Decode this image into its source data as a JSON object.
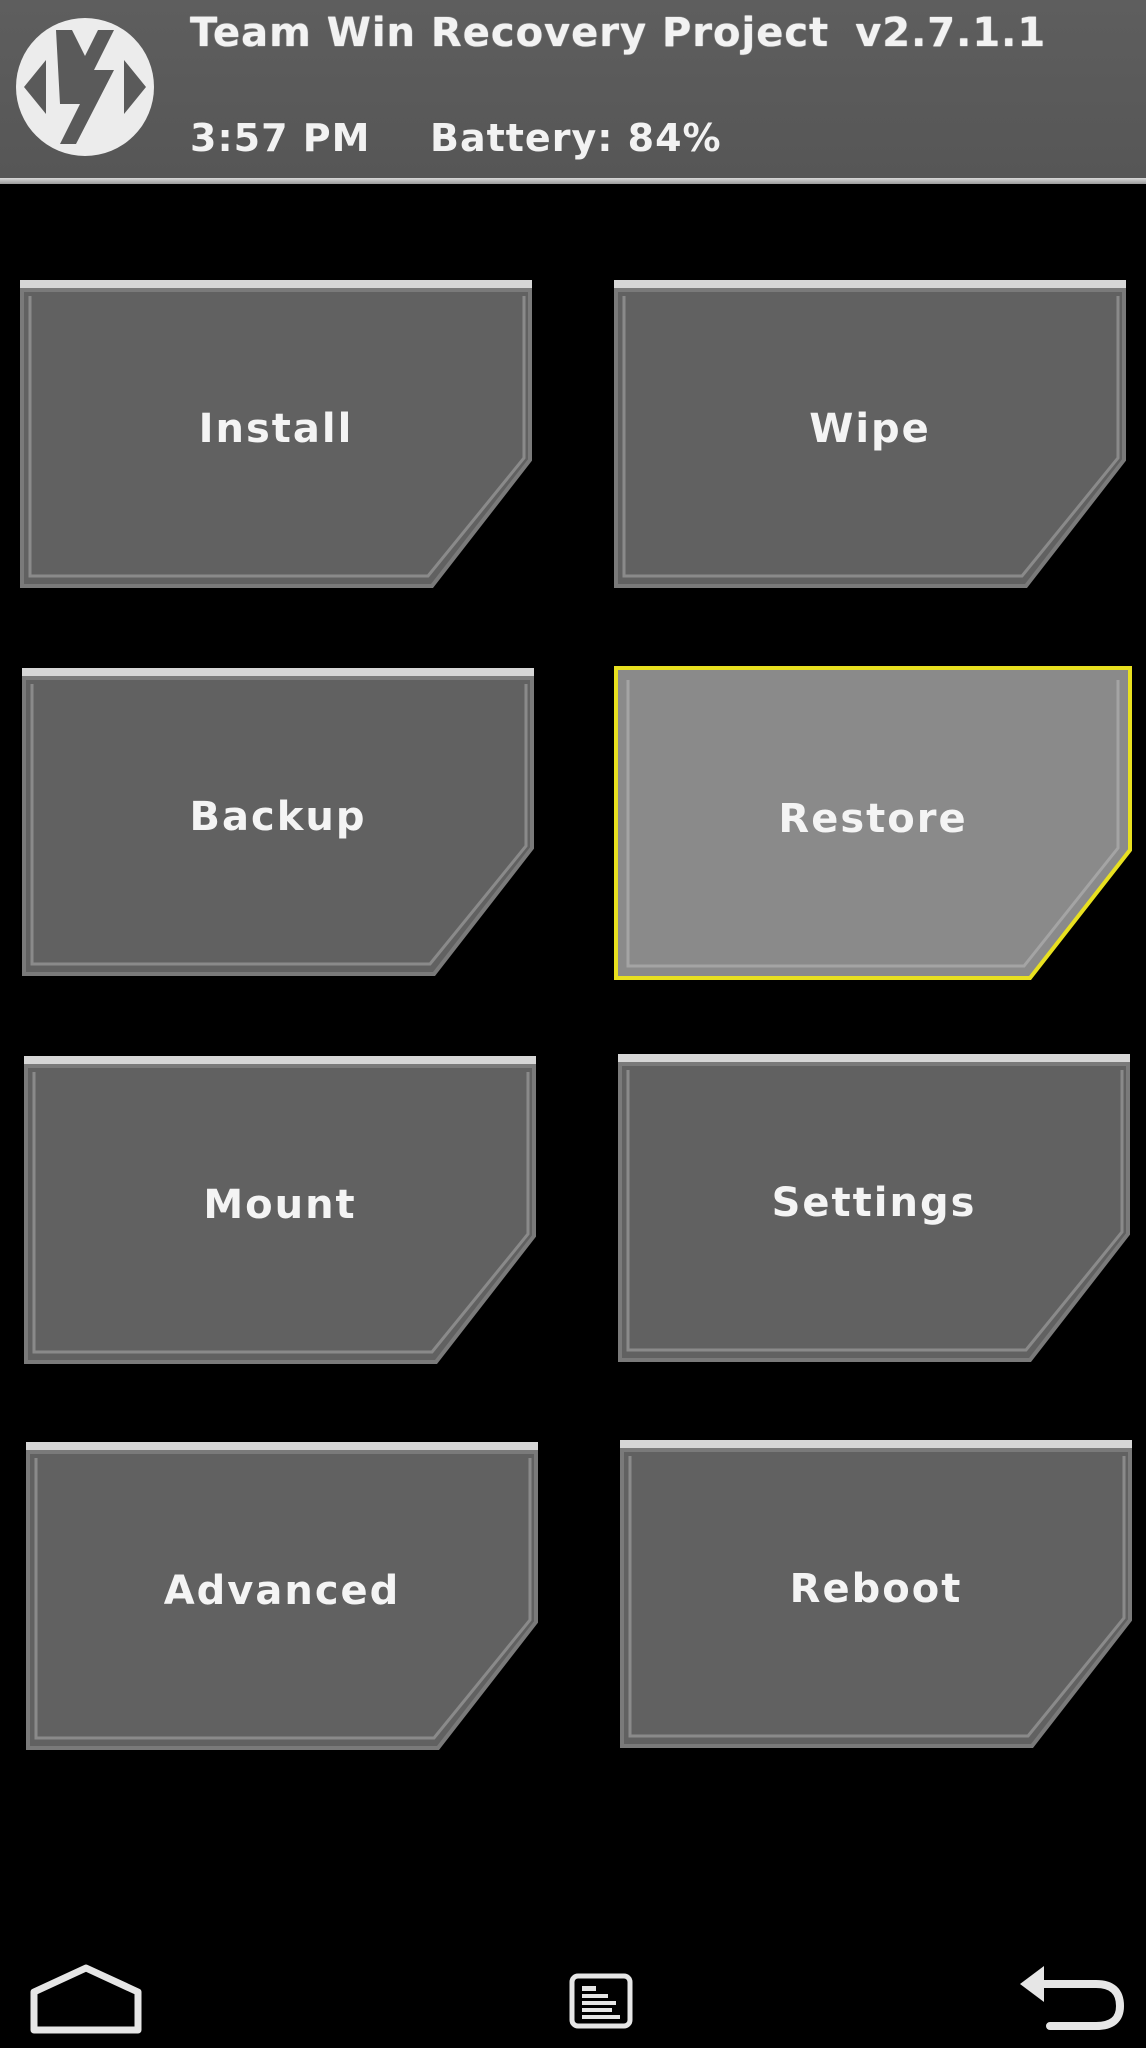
{
  "header": {
    "title": "Team Win Recovery Project",
    "version": "v2.7.1.1",
    "time": "3:57 PM",
    "battery": "Battery: 84%"
  },
  "menu": {
    "install": "Install",
    "wipe": "Wipe",
    "backup": "Backup",
    "restore": "Restore",
    "mount": "Mount",
    "settings": "Settings",
    "advanced": "Advanced",
    "reboot": "Reboot"
  },
  "selected": "Restore",
  "colors": {
    "background": "#000000",
    "tile": "#616161",
    "tile_selected": "#888888",
    "highlight": "#e8e020",
    "header": "#5a5a5a"
  },
  "nav": {
    "home": "home-icon",
    "console": "console-icon",
    "back": "back-icon"
  }
}
